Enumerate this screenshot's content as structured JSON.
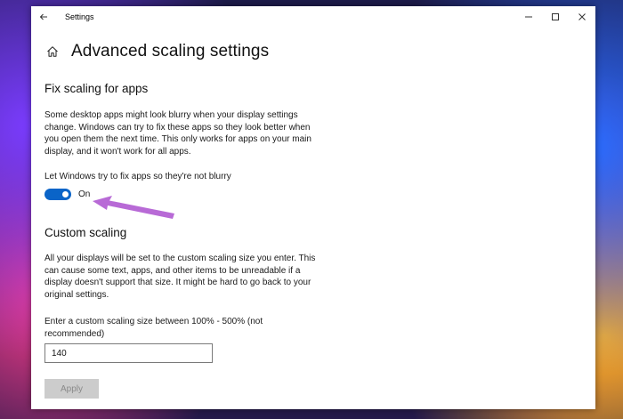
{
  "window": {
    "title": "Settings"
  },
  "page": {
    "title": "Advanced scaling settings"
  },
  "fix_scaling": {
    "heading": "Fix scaling for apps",
    "description": "Some desktop apps might look blurry when your display settings change. Windows can try to fix these apps so they look better when you open them the next time. This only works for apps on your main display, and it won't work for all apps.",
    "toggle_label": "Let Windows try to fix apps so they're not blurry",
    "toggle_state": "On",
    "toggle_on": true
  },
  "custom_scaling": {
    "heading": "Custom scaling",
    "description": "All your displays will be set to the custom scaling size you enter. This can cause some text, apps, and other items to be unreadable if a display doesn't support that size. It might be hard to go back to your original settings.",
    "input_label": "Enter a custom scaling size between 100% - 500% (not recommended)",
    "input_value": "140",
    "apply_label": "Apply",
    "apply_enabled": false
  },
  "colors": {
    "accent": "#0a64c8",
    "annotation_arrow": "#b86ad6",
    "button_disabled_bg": "#cccccc"
  },
  "icons": {
    "back": "back-arrow-icon",
    "home": "home-icon",
    "minimize": "minimize-icon",
    "maximize": "maximize-icon",
    "close": "close-icon"
  }
}
